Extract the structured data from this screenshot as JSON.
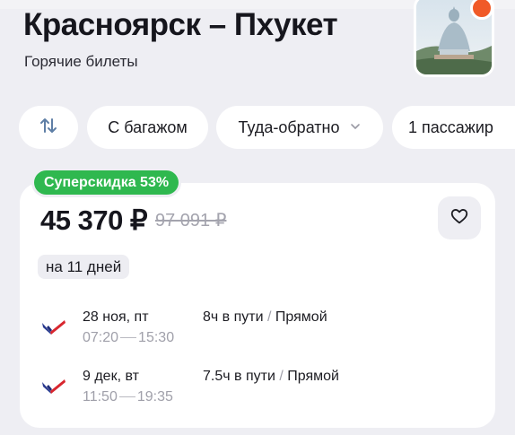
{
  "header": {
    "title": "Красноярск – Пхукет",
    "subtitle": "Горячие билеты",
    "destination_image": "phuket-big-buddha-photo"
  },
  "filters": [
    {
      "id": "sort",
      "icon": "sort-arrows-icon"
    },
    {
      "id": "baggage",
      "label": "С багажом"
    },
    {
      "id": "trip",
      "label": "Туда-обратно",
      "icon": "chevron-down-icon"
    },
    {
      "id": "passengers",
      "label": "1 пассажир"
    }
  ],
  "offer": {
    "badge": "Суперскидка 53%",
    "price": "45 370 ₽",
    "old_price": "97 091 ₽",
    "duration": "на 11 дней",
    "favorite_icon": "heart-icon",
    "segments": [
      {
        "airline_logo": "airline-logo",
        "date": "28 ноя, пт",
        "dep": "07:20",
        "arr": "15:30",
        "travel": "8ч в пути",
        "sep": "/",
        "type": "Прямой"
      },
      {
        "airline_logo": "airline-logo",
        "date": "9 дек, вт",
        "dep": "11:50",
        "arr": "19:35",
        "travel": "7.5ч в пути",
        "sep": "/",
        "type": "Прямой"
      }
    ]
  },
  "colors": {
    "badge_green": "#2fb84f",
    "page_bg": "#eeeef3",
    "card_bg": "#ffffff",
    "muted_text": "#a0a0aa"
  }
}
